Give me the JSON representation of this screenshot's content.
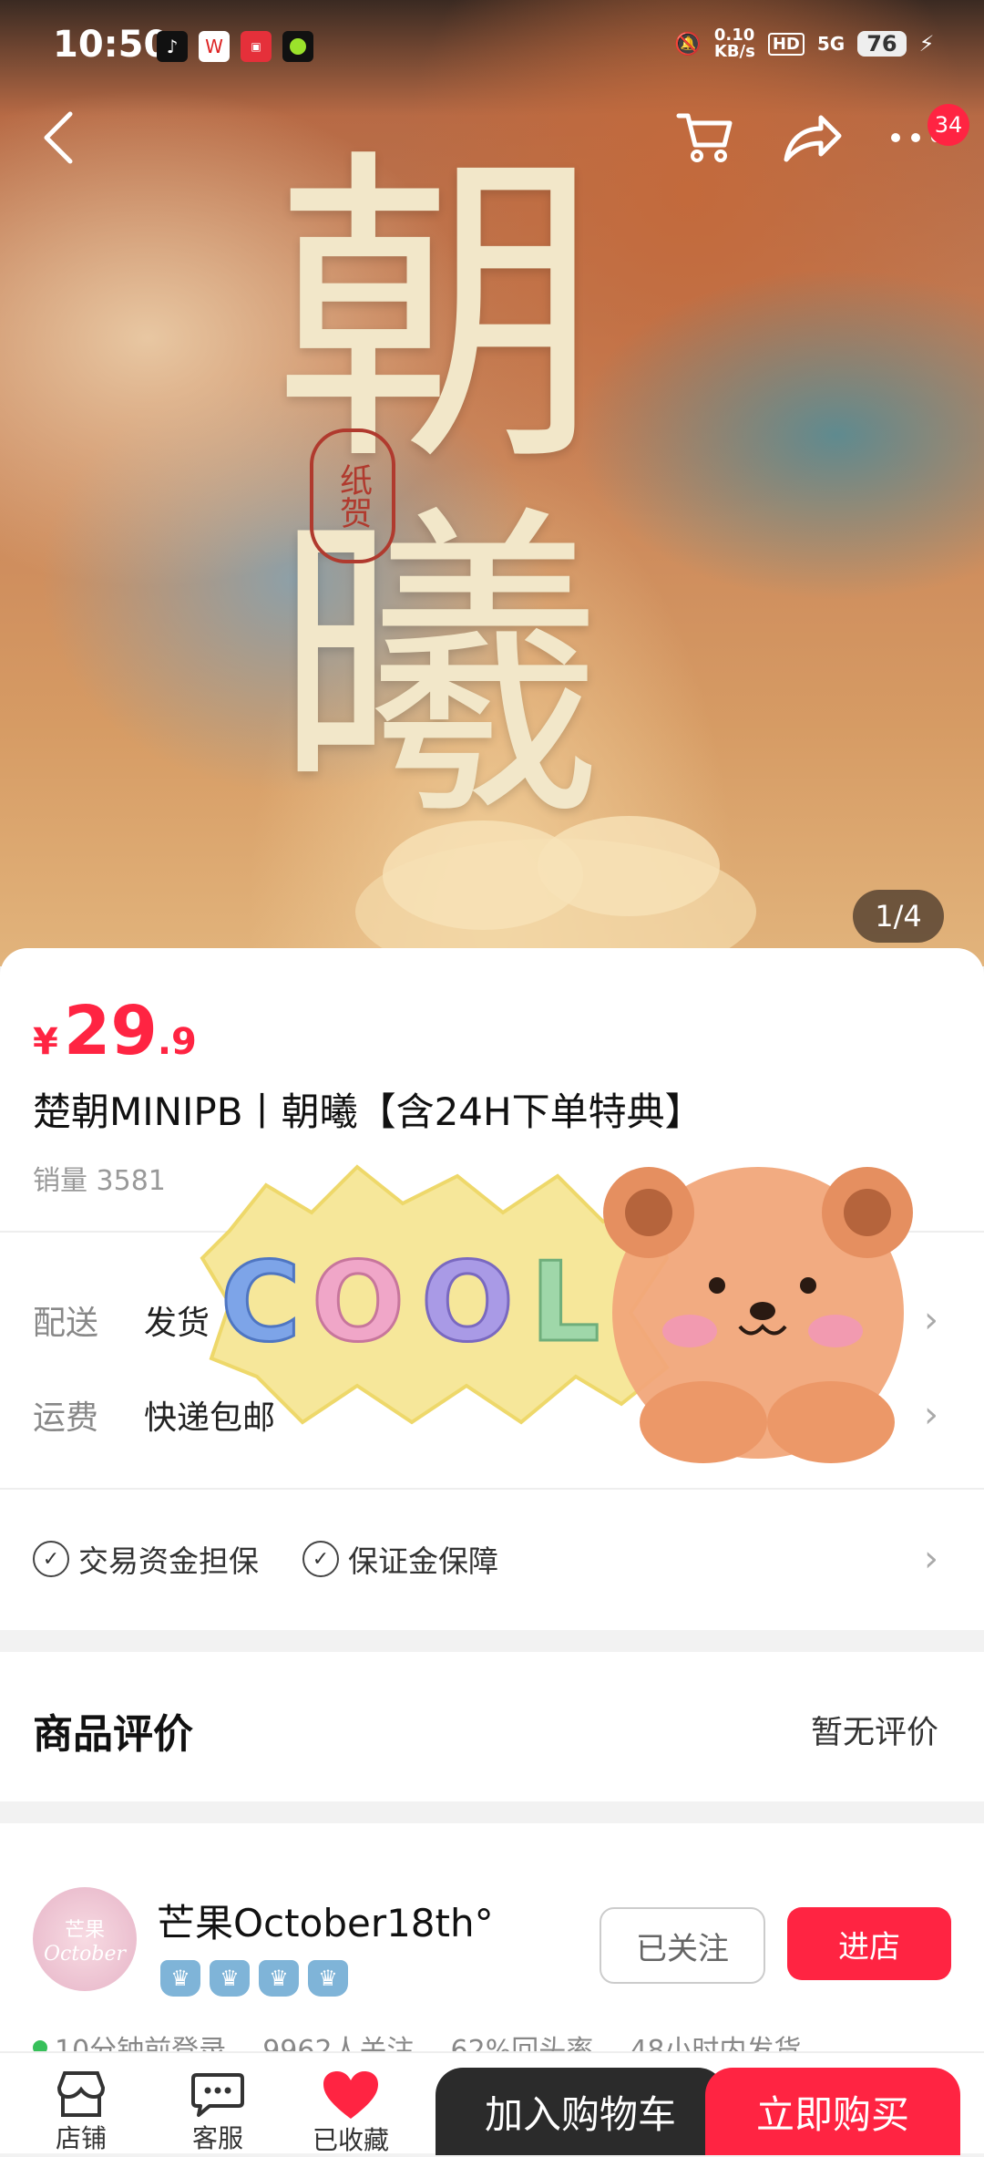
{
  "status_bar": {
    "time": "10:50",
    "network_speed": "0.10",
    "network_unit": "KB/s",
    "hd": "HD",
    "signal": "5G",
    "battery": "76"
  },
  "hero": {
    "artwork_title": "朝曦",
    "seal_text": "纸贺",
    "image_counter": "1/4",
    "cart_icon": "cart-icon",
    "share_icon": "share-icon",
    "more_badge": "34"
  },
  "product": {
    "price_currency": "¥",
    "price_integer": "29",
    "price_decimal": ".9",
    "title": "楚朝MINIPB丨朝曦【含24H下单特典】",
    "sales": "销量 3581"
  },
  "delivery": {
    "label": "配送",
    "value": "发货",
    "shipping_label": "运费",
    "shipping_value": "快递包邮"
  },
  "guarantees": [
    "交易资金担保",
    "保证金保障"
  ],
  "reviews": {
    "title": "商品评价",
    "status": "暂无评价"
  },
  "shop": {
    "avatar_text_top": "芒果",
    "avatar_text_bottom": "October",
    "name": "芒果October18th°",
    "follow_label": "已关注",
    "enter_label": "进店",
    "stats": [
      "10分钟前登录",
      "9962人关注",
      "62%回头率",
      "48小时内发货"
    ]
  },
  "sticker": {
    "text": "COOL"
  },
  "bottom_bar": {
    "shop_label": "店铺",
    "service_label": "客服",
    "favorite_label": "已收藏",
    "add_cart_label": "加入购物车",
    "buy_label": "立即购买"
  },
  "colors": {
    "accent": "#ff2442",
    "dark_button": "#2b2b2b"
  }
}
